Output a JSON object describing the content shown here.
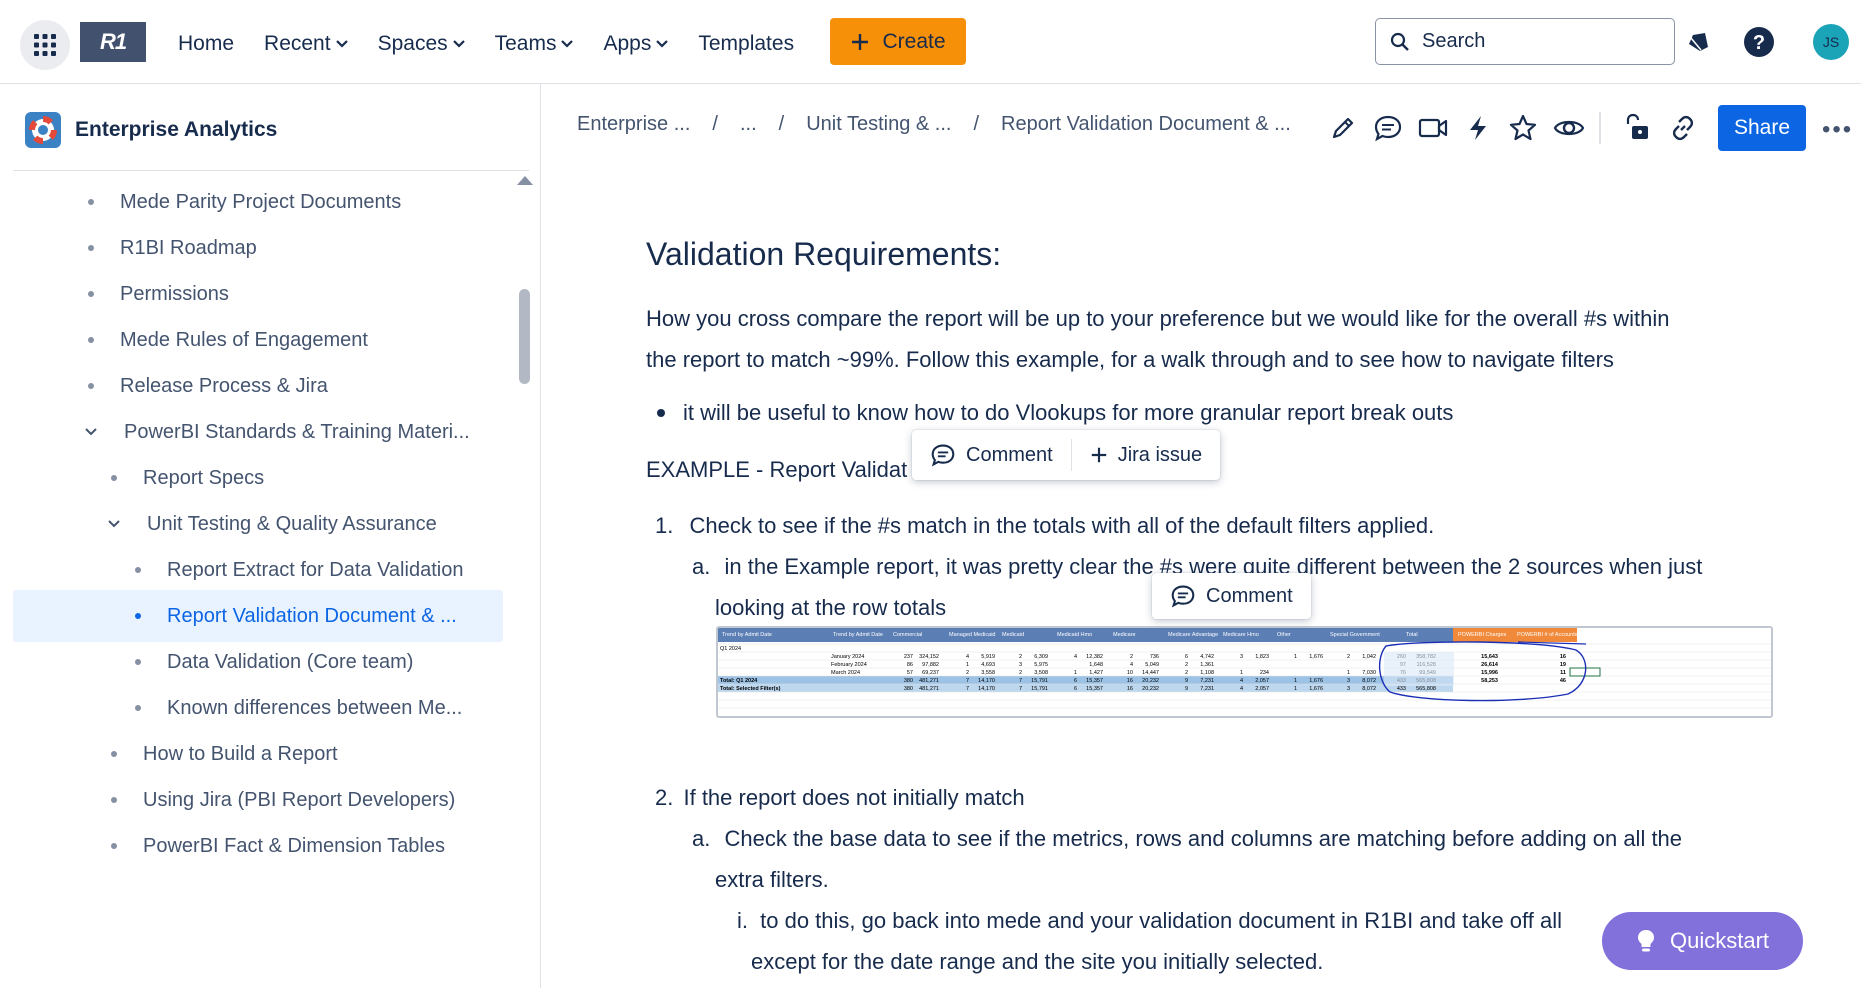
{
  "topbar": {
    "logo_text": "R1",
    "nav": [
      {
        "label": "Home",
        "has_menu": false
      },
      {
        "label": "Recent",
        "has_menu": true
      },
      {
        "label": "Spaces",
        "has_menu": true
      },
      {
        "label": "Teams",
        "has_menu": true
      },
      {
        "label": "Apps",
        "has_menu": true
      },
      {
        "label": "Templates",
        "has_menu": false
      }
    ],
    "create_label": "Create",
    "search_label": "Search",
    "avatar_initials": "JS",
    "icons": [
      "apps-grid-icon",
      "notifications-icon",
      "help-icon"
    ]
  },
  "sidebar": {
    "space_name": "Enterprise Analytics",
    "items": [
      {
        "label": "Mede Parity Project Documents",
        "level": 0,
        "type": "bullet"
      },
      {
        "label": "R1BI Roadmap",
        "level": 0,
        "type": "bullet"
      },
      {
        "label": "Permissions",
        "level": 0,
        "type": "bullet"
      },
      {
        "label": "Mede Rules of Engagement",
        "level": 0,
        "type": "bullet"
      },
      {
        "label": "Release Process & Jira",
        "level": 0,
        "type": "bullet"
      },
      {
        "label": "PowerBI Standards & Training Materi...",
        "level": 0,
        "type": "expanded"
      },
      {
        "label": "Report Specs",
        "level": 1,
        "type": "bullet"
      },
      {
        "label": "Unit Testing & Quality Assurance",
        "level": 1,
        "type": "expanded"
      },
      {
        "label": "Report Extract for Data Validation",
        "level": 2,
        "type": "bullet"
      },
      {
        "label": "Report Validation Document & ...",
        "level": 2,
        "type": "bullet",
        "selected": true
      },
      {
        "label": "Data Validation (Core team)",
        "level": 2,
        "type": "bullet"
      },
      {
        "label": "Known differences between Me...",
        "level": 2,
        "type": "bullet"
      },
      {
        "label": "How to Build a Report",
        "level": 1,
        "type": "bullet"
      },
      {
        "label": "Using Jira (PBI Report Developers)",
        "level": 1,
        "type": "bullet"
      },
      {
        "label": "PowerBI Fact & Dimension Tables",
        "level": 1,
        "type": "bullet"
      }
    ]
  },
  "breadcrumb": {
    "items": [
      "Enterprise ...",
      "...",
      "Unit Testing & ...",
      "Report Validation Document & ..."
    ],
    "separator": "/"
  },
  "toolbar": {
    "share_label": "Share",
    "more_label": "•••",
    "icons": [
      "edit-icon",
      "comment-icon",
      "video-icon",
      "automation-icon",
      "star-icon",
      "watch-icon",
      "restrictions-icon",
      "copy-link-icon"
    ]
  },
  "content": {
    "heading": "Validation Requirements:",
    "intro_line1": "How you cross compare the report will be up to your preference but we would like for the overall #s within",
    "intro_line2": "the report to match ~99%. Follow this example, for a walk through and to see how to navigate filters",
    "bullet1": "it will be useful to know how to do Vlookups for more granular report break outs",
    "example_link": "EXAMPLE - Report Validat",
    "step1_num": "1.",
    "step1": "Check to see if the #s match in the totals with all of the default filters applied.",
    "step1a_num": "a.",
    "step1a_line1": "in the Example report, it was pretty clear the #s were quite different between the 2 sources when just",
    "step1a_line2": "looking at the row totals",
    "step2_num": "2.",
    "step2": "If the report does not initially match",
    "step2a_num": "a.",
    "step2a_line1": "Check the base data to see if the metrics, rows and columns are matching before adding on all the",
    "step2a_line2": "extra filters.",
    "step2ai_num": "i.",
    "step2ai_line1": "to do this, go back into mede and your validation document in R1BI and take off all",
    "step2ai_line2": "except for the date range and the site you initially selected."
  },
  "popups": {
    "comment_label": "Comment",
    "jira_label": "Jira issue",
    "comment2_label": "Comment"
  },
  "quickstart_label": "Quickstart",
  "spreadsheet": {
    "headers": [
      "Trend by Admit Date",
      "Trend by Admit Date",
      "Commercial",
      "Managed Medicaid",
      "Medicaid",
      "Medicaid Hmo",
      "Medicare",
      "Medicare Advantage",
      "Medicare Hmo",
      "Other",
      "Special Government",
      "Total",
      "POWERBI Charges",
      "POWERBI # of Accounts"
    ],
    "period": "Q1 2024",
    "rows": [
      {
        "label": "January 2024",
        "values": [
          "237",
          "324,152",
          "4",
          "5,919",
          "2",
          "6,309",
          "4",
          "12,382",
          "2",
          "736",
          "6",
          "4,742",
          "3",
          "1,823",
          "1",
          "1,676",
          "2",
          "1,042",
          "260",
          "358,782"
        ],
        "pbi_charges": "15,643",
        "pbi_accounts": "16"
      },
      {
        "label": "February 2024",
        "values": [
          "86",
          "97,882",
          "1",
          "4,693",
          "3",
          "5,975",
          "",
          "1,648",
          "4",
          "5,049",
          "2",
          "1,361",
          "",
          "",
          "",
          "",
          "",
          "",
          "97",
          "116,528"
        ],
        "pbi_charges": "26,614",
        "pbi_accounts": "19"
      },
      {
        "label": "March 2024",
        "values": [
          "57",
          "69,237",
          "2",
          "3,558",
          "2",
          "3,508",
          "1",
          "1,427",
          "10",
          "14,447",
          "2",
          "1,108",
          "1",
          "234",
          "",
          "",
          "1",
          "7,030",
          "76",
          "99,549"
        ],
        "pbi_charges": "15,996",
        "pbi_accounts": "11"
      },
      {
        "label": "Total: Q1 2024",
        "values": [
          "380",
          "481,271",
          "7",
          "14,170",
          "7",
          "15,791",
          "6",
          "15,357",
          "16",
          "20,232",
          "9",
          "7,231",
          "4",
          "2,057",
          "1",
          "1,676",
          "3",
          "8,072",
          "433",
          "565,808"
        ],
        "pbi_charges": "58,253",
        "pbi_accounts": "46"
      },
      {
        "label": "Total: Selected Filter(s)",
        "values": [
          "380",
          "481,271",
          "7",
          "14,170",
          "7",
          "15,791",
          "6",
          "15,357",
          "16",
          "20,232",
          "9",
          "7,231",
          "4",
          "2,057",
          "1",
          "1,676",
          "3",
          "8,072",
          "433",
          "565,808"
        ],
        "pbi_charges": "",
        "pbi_accounts": ""
      }
    ]
  },
  "colors": {
    "accent": "#0c66e4",
    "create": "#f79009",
    "quickstart": "#8270db",
    "selected_bg": "#e9f2ff"
  }
}
